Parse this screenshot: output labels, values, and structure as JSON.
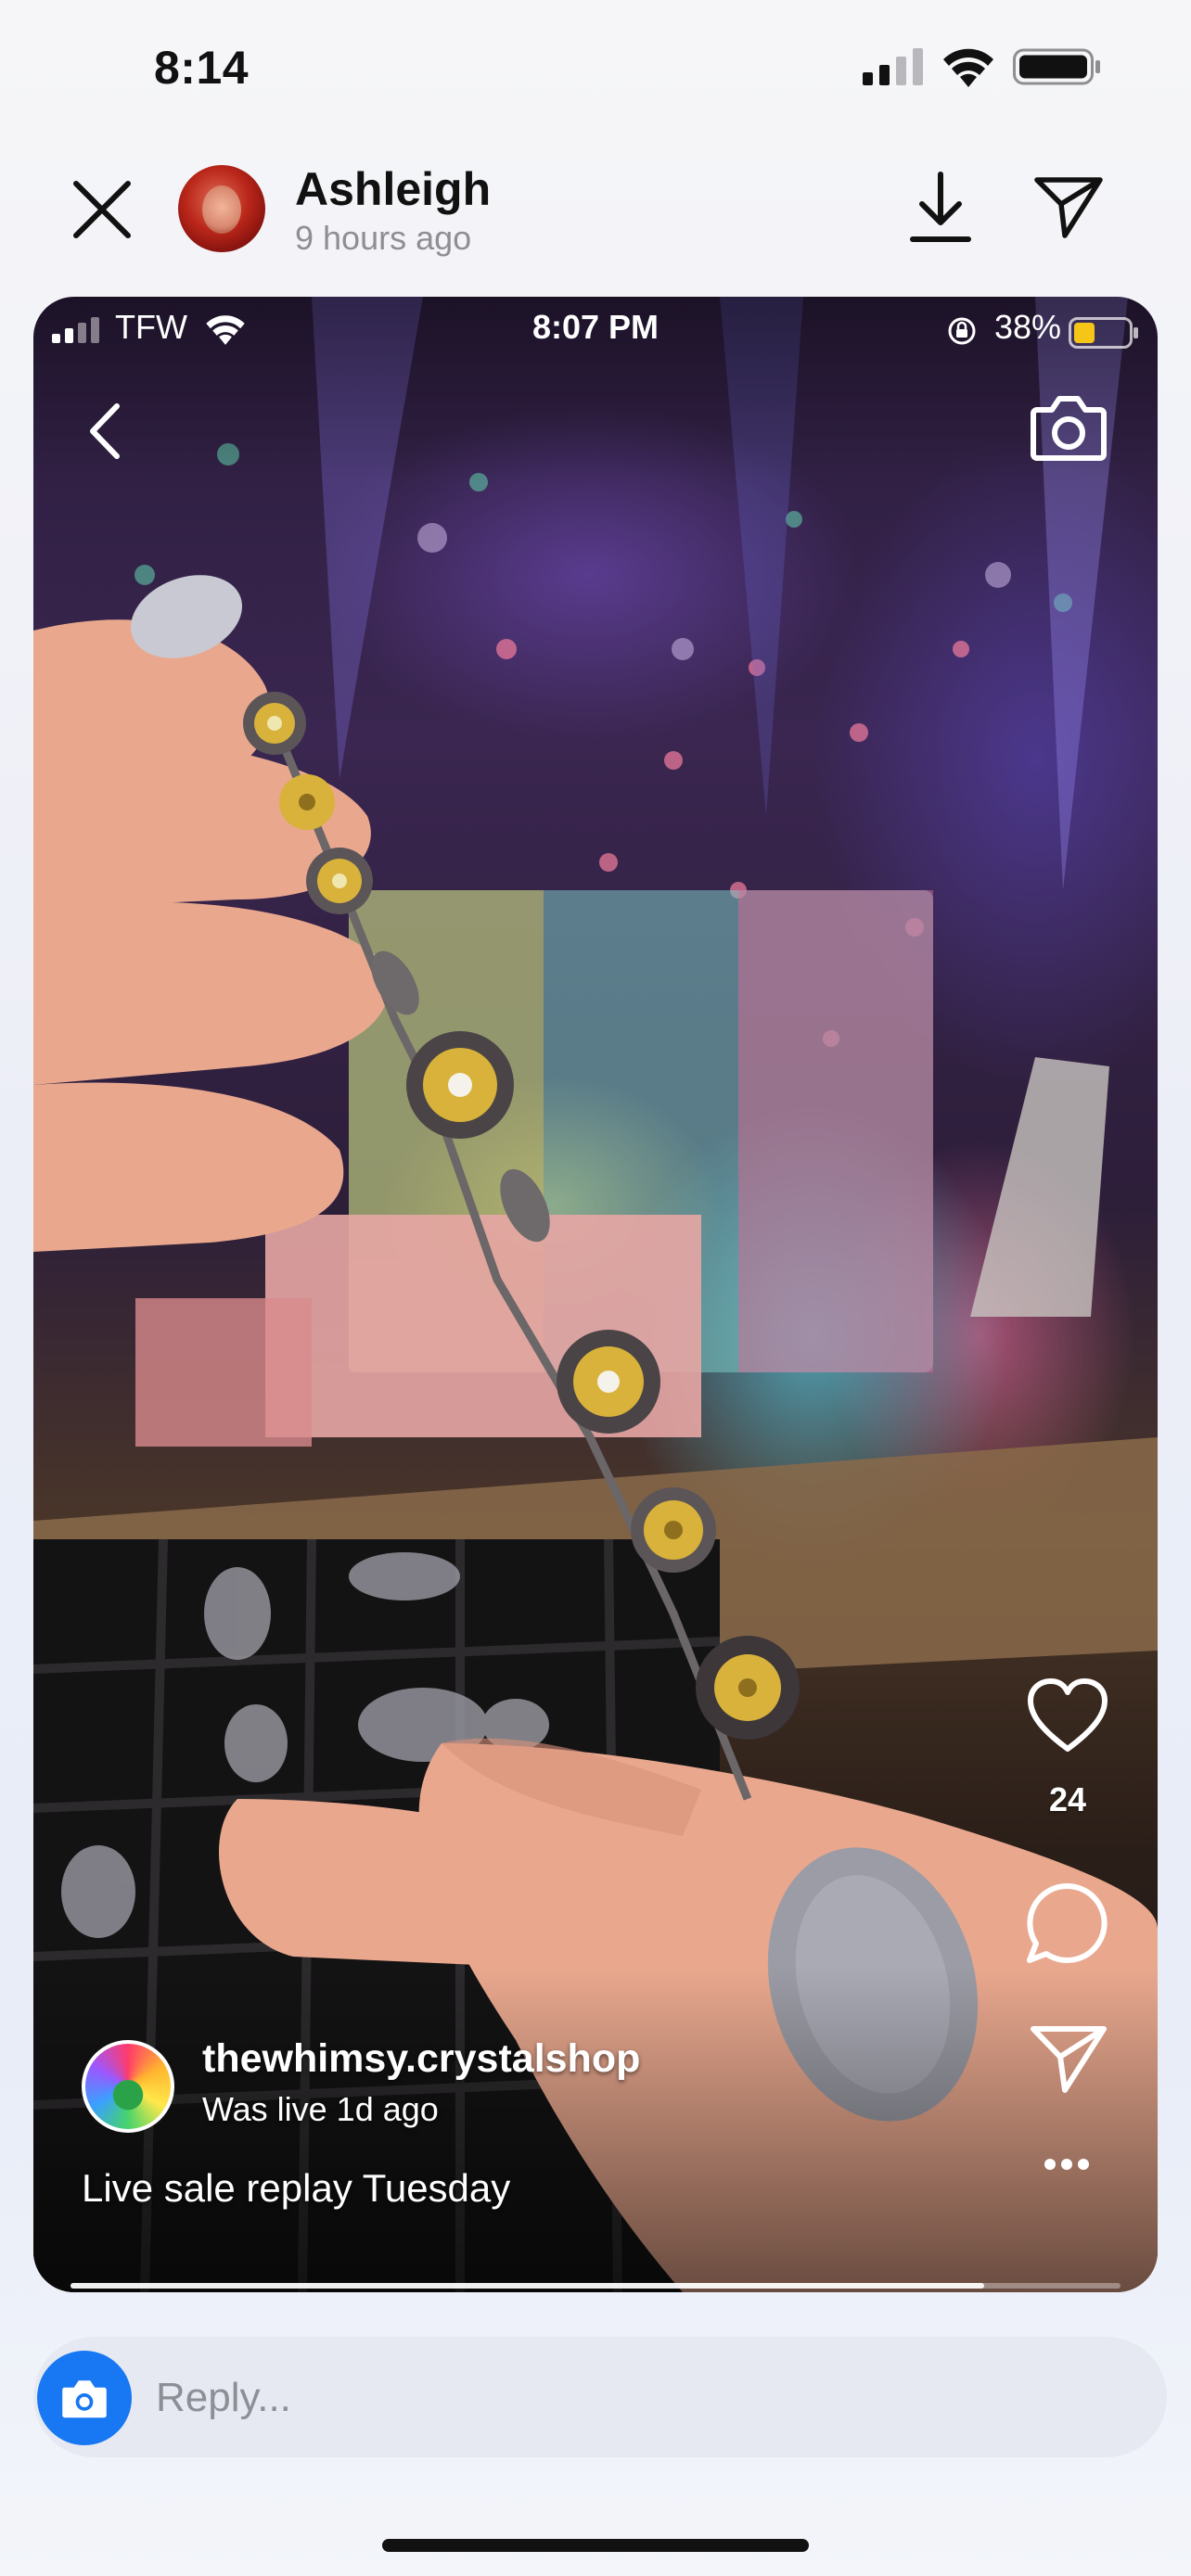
{
  "status_bar": {
    "time": "8:14",
    "signal_icon": "cellular-signal-icon",
    "wifi_icon": "wifi-icon",
    "battery_icon": "battery-icon"
  },
  "header": {
    "name": "Ashleigh",
    "time_ago": "9 hours ago",
    "close_icon": "close-icon",
    "download_icon": "download-icon",
    "share_icon": "paper-plane-icon"
  },
  "story": {
    "inner_status": {
      "carrier": "TFW",
      "time": "8:07 PM",
      "battery": "38%"
    },
    "back_icon": "chevron-left-icon",
    "camera_icon": "camera-icon",
    "like_count": "24",
    "account_name": "thewhimsy.crystalshop",
    "live_status": "Was live 1d ago",
    "caption": "Live sale replay Tuesday",
    "progress": 0.87
  },
  "reply": {
    "placeholder": "Reply..."
  },
  "colors": {
    "accent": "#1877f2",
    "bracelet_gold": "#d8b23a",
    "background": "#f3f5fa"
  }
}
